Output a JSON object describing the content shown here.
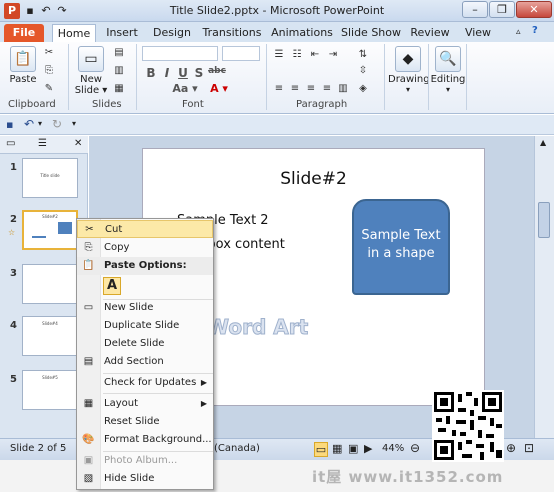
{
  "window": {
    "title": "Title Slide2.pptx - Microsoft PowerPoint",
    "minimize": "–",
    "restore": "❐",
    "close": "✕"
  },
  "tabs": [
    "File",
    "Home",
    "Insert",
    "Design",
    "Transitions",
    "Animations",
    "Slide Show",
    "Review",
    "View"
  ],
  "ribbon": {
    "clipboard": {
      "label": "Clipboard",
      "paste": "Paste"
    },
    "slides": {
      "label": "Slides",
      "new_slide_1": "New",
      "new_slide_2": "Slide ▾"
    },
    "font": {
      "label": "Font",
      "bold": "B",
      "italic": "I",
      "underline": "U",
      "strike": "S",
      "shadow": "abc",
      "aa": "Aa ▾",
      "a_color": "A ▾"
    },
    "paragraph": {
      "label": "Paragraph"
    },
    "drawing": {
      "label": "Drawing"
    },
    "editing": {
      "label": "Editing"
    }
  },
  "thumbnails": [
    {
      "num": "1",
      "title": "Title slide"
    },
    {
      "num": "2",
      "title": "Slide#2"
    },
    {
      "num": "3",
      "title": ""
    },
    {
      "num": "4",
      "title": "Slide#4"
    },
    {
      "num": "5",
      "title": "Slide#5"
    }
  ],
  "slide": {
    "title": "Slide#2",
    "text1": "Sample Text 2",
    "text2": "Text box content",
    "shape_text_1": "Sample Text",
    "shape_text_2": "in a shape",
    "wordart": "Word Art"
  },
  "statusbar": {
    "slide_info": "Slide 2 of 5",
    "language": "(Canada)",
    "zoom": "44%"
  },
  "context_menu": {
    "cut": "Cut",
    "copy": "Copy",
    "paste_options": "Paste Options:",
    "paste_keep": "A",
    "new_slide": "New Slide",
    "duplicate_slide": "Duplicate Slide",
    "delete_slide": "Delete Slide",
    "add_section": "Add Section",
    "check_updates": "Check for Updates",
    "layout": "Layout",
    "reset_slide": "Reset Slide",
    "format_background": "Format Background...",
    "photo_album": "Photo Album...",
    "hide_slide": "Hide Slide"
  },
  "watermark": "it屋 www.it1352.com",
  "colors": {
    "file_tab": "#e5572a",
    "shape_fill": "#4f81bd",
    "menu_highlight": "#fce9a8"
  }
}
